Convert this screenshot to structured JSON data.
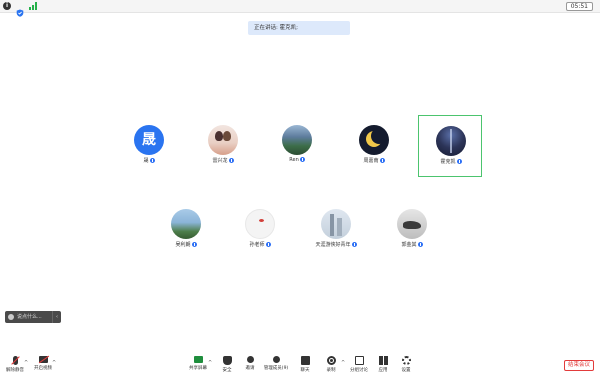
{
  "topbar": {
    "timer": "05:51"
  },
  "speaking_banner": "正在讲话: 霍克凯;",
  "participants": [
    {
      "name": "晟",
      "avatar_text": "晟"
    },
    {
      "name": "雷兴龙"
    },
    {
      "name": "Ren"
    },
    {
      "name": "周嘉南"
    },
    {
      "name": "霍克凯",
      "active": true
    },
    {
      "name": "吴利朗"
    },
    {
      "name": "孙老师"
    },
    {
      "name": "天涯游侠好青年"
    },
    {
      "name": "郭金其"
    }
  ],
  "chat": {
    "placeholder": "说点什么...",
    "arrow": "‹"
  },
  "toolbar": {
    "mic_label": "解除静音",
    "video_label": "开启视频",
    "share_label": "共享屏幕",
    "security_label": "安全",
    "invite_label": "邀请",
    "manage_label": "管理成员(9)",
    "chat_label": "聊天",
    "record_label": "录制",
    "groups_label": "分组讨论",
    "apps_label": "应用",
    "settings_label": "设置",
    "end_label": "结束会议",
    "caret": "^"
  },
  "colors": {
    "accent": "#2a74f0",
    "active_border": "#4cc46e",
    "danger": "#e23b3b",
    "share": "#1f8e3d"
  }
}
